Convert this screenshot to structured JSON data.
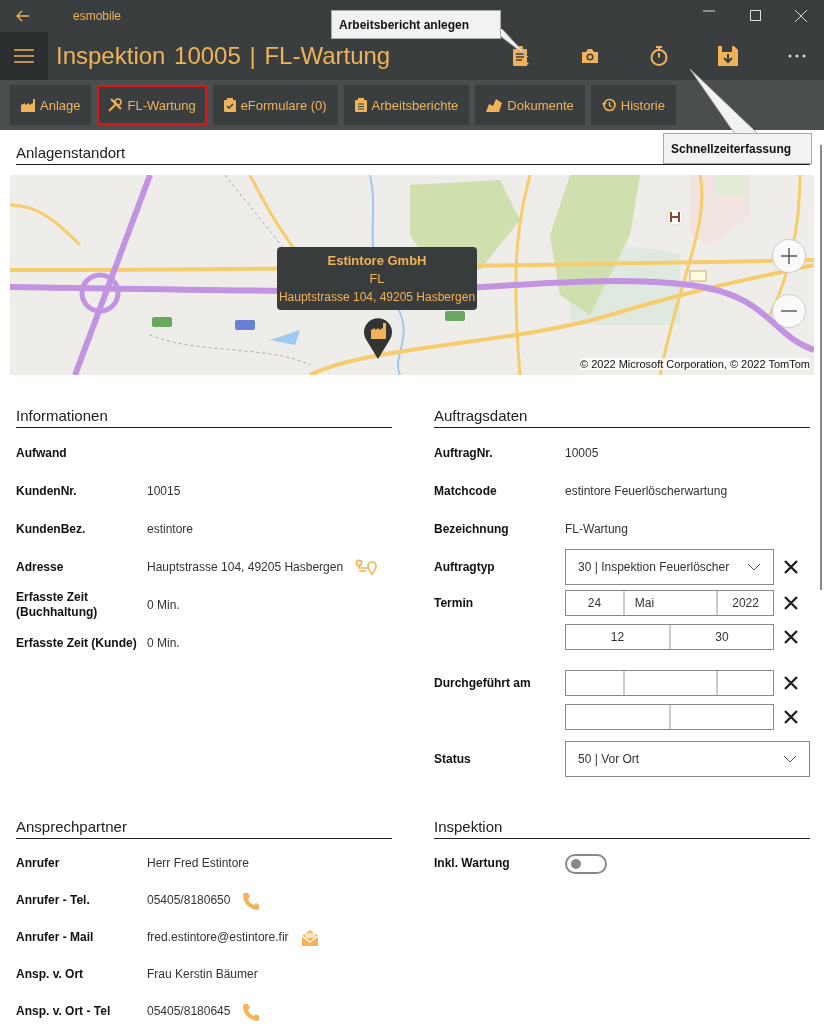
{
  "window": {
    "app_name": "esmobile"
  },
  "app_bar": {
    "title": "Inspektion 10005 | FL-Wartung"
  },
  "tooltips": [
    {
      "text": "Arbeitsbericht anlegen"
    },
    {
      "text": "Schnellzeiterfassung"
    }
  ],
  "tabs": [
    {
      "label": "Anlage",
      "selected": false
    },
    {
      "label": "FL-Wartung",
      "selected": true
    },
    {
      "label": "eFormulare (0)",
      "selected": false
    },
    {
      "label": "Arbeitsberichte",
      "selected": false
    },
    {
      "label": "Dokumente",
      "selected": false
    },
    {
      "label": "Historie",
      "selected": false
    }
  ],
  "location": {
    "heading": "Anlagenstandort",
    "popup": {
      "title": "Estintore GmbH",
      "subtitle": "FL",
      "address": "Hauptstrasse 104, 49205 Hasbergen"
    },
    "copyright": "© 2022 Microsoft Corporation, © 2022 TomTom"
  },
  "informationen": {
    "heading": "Informationen",
    "rows": [
      {
        "kind": "text",
        "label": "Aufwand"
      },
      {
        "kind": "text",
        "label": "KundenNr.",
        "value": "10015"
      },
      {
        "kind": "text",
        "label": "KundenBez.",
        "value": "estintore"
      },
      {
        "kind": "route",
        "label": "Adresse",
        "value": "Hauptstrasse 104, 49205 Hasbergen"
      },
      {
        "kind": "text",
        "label": "Erfasste Zeit (Buchhaltung)",
        "value": "0 Min."
      },
      {
        "kind": "text",
        "label": "Erfasste Zeit (Kunde)",
        "value": "0 Min."
      }
    ]
  },
  "auftragsdaten": {
    "heading": "Auftragsdaten",
    "rows": [
      {
        "kind": "text",
        "label": "AuftragNr.",
        "value": "10005"
      },
      {
        "kind": "text",
        "label": "Matchcode",
        "value": "estintore Feuerlöscherwartung"
      },
      {
        "kind": "text",
        "label": "Bezeichnung",
        "value": "FL-Wartung"
      },
      {
        "kind": "dropdown",
        "label": "Auftragtyp",
        "value": "30 | Inspektion Feuerlöscher",
        "clearable": true
      },
      {
        "kind": "date",
        "label": "Termin",
        "parts": [
          "24",
          "Mai",
          "2022"
        ]
      },
      {
        "kind": "time",
        "parts": [
          "12",
          "30"
        ]
      },
      {
        "kind": "date",
        "label": "Durchgeführt am"
      },
      {
        "kind": "time"
      },
      {
        "kind": "dropdown",
        "label": "Status",
        "value": "50 | Vor Ort",
        "clearable": false
      }
    ]
  },
  "ansprechpartner": {
    "heading": "Ansprechpartner",
    "rows": [
      {
        "kind": "text",
        "label": "Anrufer",
        "value": "Herr Fred Estintore"
      },
      {
        "kind": "phone",
        "label": "Anrufer - Tel.",
        "value": "05405/8180650"
      },
      {
        "kind": "mail",
        "label": "Anrufer - Mail",
        "value": "fred.estintore@estintore.fir"
      },
      {
        "kind": "text",
        "label": "Ansp. v. Ort",
        "value": "Frau Kerstin Bäumer"
      },
      {
        "kind": "phone",
        "label": "Ansp. v. Ort - Tel",
        "value": "05405/8180645"
      }
    ]
  },
  "inspektion": {
    "heading": "Inspektion",
    "rows": [
      {
        "kind": "toggle",
        "label": "Inkl. Wartung",
        "on": false
      }
    ]
  }
}
